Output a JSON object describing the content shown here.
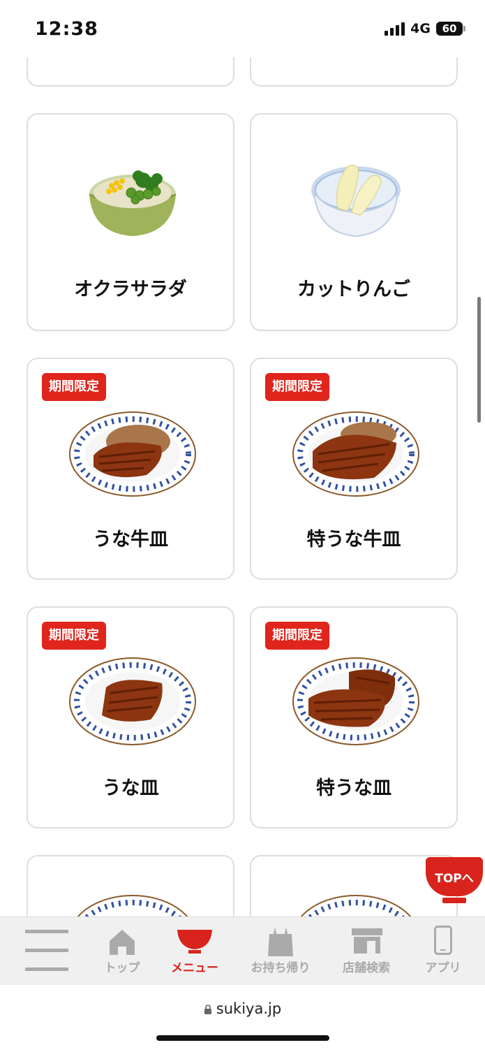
{
  "status_bar": {
    "time": "12:38",
    "network": "4G",
    "battery": "60"
  },
  "menu_items": [
    {
      "title": "オクラサラダ",
      "badge": ""
    },
    {
      "title": "カットりんご",
      "badge": ""
    },
    {
      "title": "うな牛皿",
      "badge": "期間限定"
    },
    {
      "title": "特うな牛皿",
      "badge": "期間限定"
    },
    {
      "title": "うな皿",
      "badge": "期間限定"
    },
    {
      "title": "特うな皿",
      "badge": "期間限定"
    }
  ],
  "top_button": {
    "label": "TOPへ"
  },
  "bottom_nav": {
    "items": [
      {
        "label": ""
      },
      {
        "label": "トップ"
      },
      {
        "label": "メニュー"
      },
      {
        "label": "お持ち帰り"
      },
      {
        "label": "店舗検索"
      },
      {
        "label": "アプリ"
      }
    ],
    "active_color": "#d8241c",
    "inactive_color": "#aaaaaa"
  },
  "browser": {
    "url": "sukiya.jp"
  },
  "colors": {
    "accent": "#e0251c",
    "card_border": "#dedede"
  }
}
